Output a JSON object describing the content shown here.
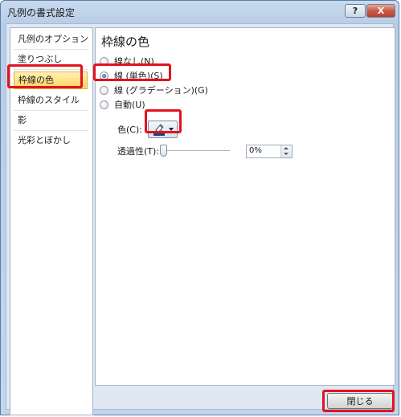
{
  "window": {
    "title": "凡例の書式設定"
  },
  "titlebar": {
    "help_label": "?",
    "close_label": "X"
  },
  "nav": {
    "items": [
      {
        "label": "凡例のオプション"
      },
      {
        "label": "塗りつぶし"
      },
      {
        "label": "枠線の色",
        "selected": true
      },
      {
        "label": "枠線のスタイル"
      },
      {
        "label": "影"
      },
      {
        "label": "光彩とぼかし"
      }
    ]
  },
  "panel": {
    "heading": "枠線の色",
    "options": [
      {
        "label": "線なし(N)",
        "checked": false
      },
      {
        "label": "線 (単色)(S)",
        "checked": true
      },
      {
        "label": "線 (グラデーション)(G)",
        "checked": false
      },
      {
        "label": "自動(U)",
        "checked": false
      }
    ],
    "color": {
      "label": "色(C):",
      "icon": "pen-color-icon"
    },
    "transparency": {
      "label": "透過性(T):",
      "value": "0%",
      "level": 0
    }
  },
  "footer": {
    "close_label": "閉じる"
  },
  "colors": {
    "highlight": "#e0141e",
    "selected_nav": "#ffd45a"
  }
}
